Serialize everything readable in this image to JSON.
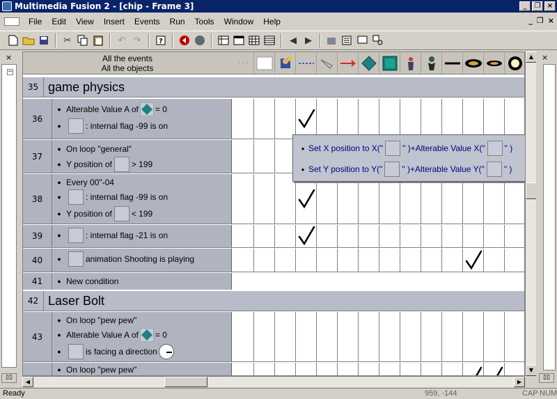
{
  "window": {
    "title": "Multimedia Fusion 2 - [chip - Frame 3]"
  },
  "menu": [
    "File",
    "Edit",
    "View",
    "Insert",
    "Events",
    "Run",
    "Tools",
    "Window",
    "Help"
  ],
  "header": {
    "line1": "All the events",
    "line2": "All the objects"
  },
  "groups": [
    {
      "num": "35",
      "title": "game physics"
    },
    {
      "num": "42",
      "title": "Laser Bolt"
    }
  ],
  "events": {
    "e36": {
      "num": "36",
      "c1_pre": "Alterable Value A of",
      "c1_post": "= 0",
      "c2": ": internal flag -99 is on"
    },
    "e37": {
      "num": "37",
      "c1": "On loop \"general\"",
      "c2_pre": "Y position of",
      "c2_post": "> 199"
    },
    "e38": {
      "num": "38",
      "c1": "Every 00\"-04",
      "c2": ": internal flag -99 is on",
      "c3_pre": "Y position of",
      "c3_post": "< 199"
    },
    "e39": {
      "num": "39",
      "c1": ": internal flag -21 is on"
    },
    "e40": {
      "num": "40",
      "c1": "animation Shooting is playing"
    },
    "e41": {
      "num": "41",
      "c1": "New condition"
    },
    "e43": {
      "num": "43",
      "c1": "On loop \"pew pew\"",
      "c2_pre": "Alterable Value A of",
      "c2_post": "= 0",
      "c3": "is facing a direction"
    },
    "e44": {
      "c1": "On loop \"pew pew\""
    }
  },
  "popup": {
    "a1_pre": "Set X position to X(\"",
    "a1_mid": "\" )+Alterable Value X(\"",
    "a1_post": "\" )",
    "a2_pre": "Set Y position to Y(\"",
    "a2_mid": "\" )+Alterable Value Y(\"",
    "a2_post": "\" )"
  },
  "status": {
    "ready": "Ready",
    "coords": "959, -144",
    "caps": "CAP",
    "num": "NUM"
  }
}
